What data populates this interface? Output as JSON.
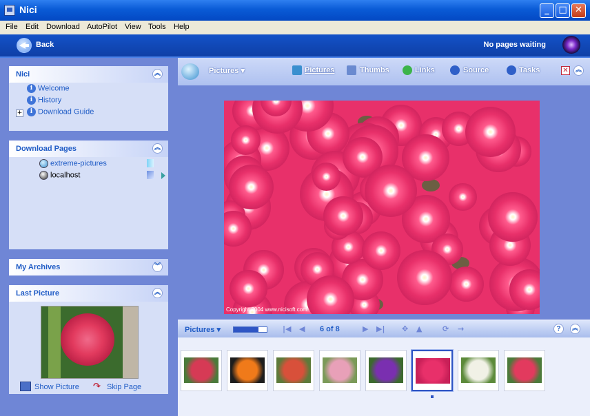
{
  "window": {
    "title": "Nici",
    "minimize": "_",
    "maximize": "□",
    "close": "✕"
  },
  "menu": [
    "File",
    "Edit",
    "Download",
    "AutoPilot",
    "View",
    "Tools",
    "Help"
  ],
  "nav": {
    "back_label": "Back",
    "status": "No pages waiting"
  },
  "panels": {
    "nici": {
      "title": "Nici",
      "items": [
        "Welcome",
        "History",
        "Download Guide"
      ]
    },
    "download_pages": {
      "title": "Download Pages",
      "items": [
        "extreme-pictures",
        "localhost"
      ]
    },
    "archives": {
      "title": "My Archives"
    },
    "last_picture": {
      "title": "Last Picture",
      "show_label": "Show Picture",
      "skip_label": "Skip Page"
    }
  },
  "toolbar": {
    "view_label": "Pictures",
    "tabs": [
      "Pictures",
      "Thumbs",
      "Links",
      "Source",
      "Tasks"
    ]
  },
  "viewer": {
    "copyright": "Copyright 2004 www.nicisoft.com",
    "accent": "#e8306a"
  },
  "filmstrip": {
    "label": "Pictures",
    "counter": "6 of 8",
    "current": 6,
    "total": 8,
    "thumbs": [
      {
        "name": "red-flowers",
        "color": "#d63a55",
        "bg": "#4b7a3a"
      },
      {
        "name": "bird-of-paradise",
        "color": "#f07a1a",
        "bg": "#1d1d1d"
      },
      {
        "name": "gerbera",
        "color": "#d8503a",
        "bg": "#5d7a3a"
      },
      {
        "name": "pink-blossoms",
        "color": "#e8a0b8",
        "bg": "#7b9a58"
      },
      {
        "name": "purple-iris",
        "color": "#7a2fb0",
        "bg": "#3c6a2e"
      },
      {
        "name": "pink-asters",
        "color": "#e8306a",
        "bg": "#c82058"
      },
      {
        "name": "white-blossoms",
        "color": "#f1f1e6",
        "bg": "#5c8a3a"
      },
      {
        "name": "red-hydrangea",
        "color": "#e23a5e",
        "bg": "#4c7a3a"
      }
    ]
  }
}
